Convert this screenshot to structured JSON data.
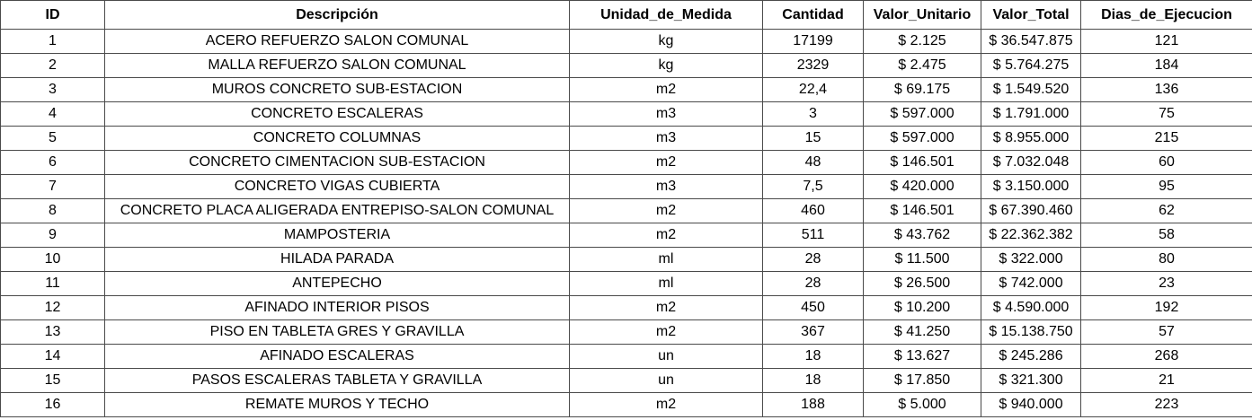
{
  "table": {
    "headers": {
      "id": "ID",
      "descripcion": "Descripción",
      "unidad": "Unidad_de_Medida",
      "cantidad": "Cantidad",
      "valor_unitario": "Valor_Unitario",
      "valor_total": "Valor_Total",
      "dias": "Dias_de_Ejecucion"
    },
    "rows": [
      {
        "id": "1",
        "descripcion": "ACERO REFUERZO SALON COMUNAL",
        "unidad": "kg",
        "cantidad": "17199",
        "valor_unitario": "$ 2.125",
        "valor_total": "$ 36.547.875",
        "dias": "121"
      },
      {
        "id": "2",
        "descripcion": "MALLA REFUERZO SALON COMUNAL",
        "unidad": "kg",
        "cantidad": "2329",
        "valor_unitario": "$ 2.475",
        "valor_total": "$ 5.764.275",
        "dias": "184"
      },
      {
        "id": "3",
        "descripcion": "MUROS CONCRETO SUB-ESTACION",
        "unidad": "m2",
        "cantidad": "22,4",
        "valor_unitario": "$ 69.175",
        "valor_total": "$ 1.549.520",
        "dias": "136"
      },
      {
        "id": "4",
        "descripcion": "CONCRETO ESCALERAS",
        "unidad": "m3",
        "cantidad": "3",
        "valor_unitario": "$ 597.000",
        "valor_total": "$ 1.791.000",
        "dias": "75"
      },
      {
        "id": "5",
        "descripcion": "CONCRETO COLUMNAS",
        "unidad": "m3",
        "cantidad": "15",
        "valor_unitario": "$ 597.000",
        "valor_total": "$ 8.955.000",
        "dias": "215"
      },
      {
        "id": "6",
        "descripcion": "CONCRETO CIMENTACION SUB-ESTACION",
        "unidad": "m2",
        "cantidad": "48",
        "valor_unitario": "$ 146.501",
        "valor_total": "$ 7.032.048",
        "dias": "60"
      },
      {
        "id": "7",
        "descripcion": "CONCRETO VIGAS CUBIERTA",
        "unidad": "m3",
        "cantidad": "7,5",
        "valor_unitario": "$ 420.000",
        "valor_total": "$ 3.150.000",
        "dias": "95"
      },
      {
        "id": "8",
        "descripcion": "CONCRETO PLACA ALIGERADA ENTREPISO-SALON COMUNAL",
        "unidad": "m2",
        "cantidad": "460",
        "valor_unitario": "$ 146.501",
        "valor_total": "$ 67.390.460",
        "dias": "62"
      },
      {
        "id": "9",
        "descripcion": "MAMPOSTERIA",
        "unidad": "m2",
        "cantidad": "511",
        "valor_unitario": "$ 43.762",
        "valor_total": "$ 22.362.382",
        "dias": "58"
      },
      {
        "id": "10",
        "descripcion": "HILADA PARADA",
        "unidad": "ml",
        "cantidad": "28",
        "valor_unitario": "$ 11.500",
        "valor_total": "$ 322.000",
        "dias": "80"
      },
      {
        "id": "11",
        "descripcion": "ANTEPECHO",
        "unidad": "ml",
        "cantidad": "28",
        "valor_unitario": "$ 26.500",
        "valor_total": "$ 742.000",
        "dias": "23"
      },
      {
        "id": "12",
        "descripcion": "AFINADO INTERIOR PISOS",
        "unidad": "m2",
        "cantidad": "450",
        "valor_unitario": "$ 10.200",
        "valor_total": "$ 4.590.000",
        "dias": "192"
      },
      {
        "id": "13",
        "descripcion": "PISO EN TABLETA GRES Y GRAVILLA",
        "unidad": "m2",
        "cantidad": "367",
        "valor_unitario": "$ 41.250",
        "valor_total": "$ 15.138.750",
        "dias": "57"
      },
      {
        "id": "14",
        "descripcion": "AFINADO ESCALERAS",
        "unidad": "un",
        "cantidad": "18",
        "valor_unitario": "$ 13.627",
        "valor_total": "$ 245.286",
        "dias": "268"
      },
      {
        "id": "15",
        "descripcion": "PASOS ESCALERAS TABLETA Y GRAVILLA",
        "unidad": "un",
        "cantidad": "18",
        "valor_unitario": "$ 17.850",
        "valor_total": "$ 321.300",
        "dias": "21"
      },
      {
        "id": "16",
        "descripcion": "REMATE MUROS Y TECHO",
        "unidad": "m2",
        "cantidad": "188",
        "valor_unitario": "$ 5.000",
        "valor_total": "$ 940.000",
        "dias": "223"
      }
    ]
  },
  "style": {
    "border_color": "#4a4a4a",
    "background": "#ffffff",
    "text_color": "#000000"
  }
}
